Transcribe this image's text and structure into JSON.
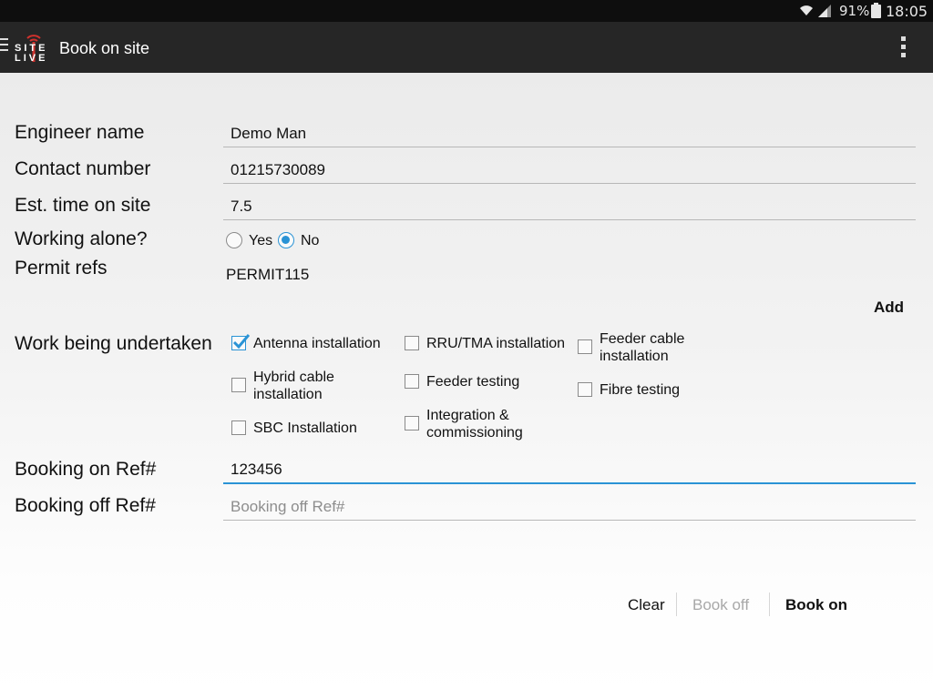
{
  "status_bar": {
    "battery_percent": "91%",
    "time": "18:05",
    "wifi_icon": "wifi-icon",
    "signal_icon": "signal-icon",
    "battery_icon": "battery-icon"
  },
  "action_bar": {
    "title": "Book on site",
    "logo_text_top": "SITE",
    "logo_text_bottom": "LIVE",
    "accent_color": "#d0312d",
    "menu_icon": "hamburger-icon",
    "overflow_icon": "overflow-menu-icon"
  },
  "form": {
    "engineer_name": {
      "label": "Engineer name",
      "value": "Demo Man"
    },
    "contact_number": {
      "label": "Contact number",
      "value": "01215730089"
    },
    "est_time": {
      "label": "Est. time on site",
      "value": "7.5"
    },
    "working_alone": {
      "label": "Working alone?",
      "options": [
        {
          "label": "Yes",
          "selected": false
        },
        {
          "label": "No",
          "selected": true
        }
      ]
    },
    "permit_refs": {
      "label": "Permit refs",
      "value": "PERMIT115",
      "add_label": "Add"
    },
    "work": {
      "label": "Work being undertaken",
      "options": [
        {
          "label": "Antenna installation",
          "checked": true
        },
        {
          "label": "RRU/TMA installation",
          "checked": false
        },
        {
          "label": "Feeder cable installation",
          "checked": false
        },
        {
          "label": "Hybrid cable installation",
          "checked": false
        },
        {
          "label": "Feeder testing",
          "checked": false
        },
        {
          "label": "Fibre testing",
          "checked": false
        },
        {
          "label": "SBC Installation",
          "checked": false
        },
        {
          "label": "Integration & commissioning",
          "checked": false
        }
      ]
    },
    "booking_on": {
      "label": "Booking on Ref#",
      "value": "123456"
    },
    "booking_off": {
      "label": "Booking off Ref#",
      "value": "",
      "placeholder": "Booking off Ref#"
    }
  },
  "buttons": {
    "clear": "Clear",
    "book_off": "Book off",
    "book_on": "Book on"
  },
  "colors": {
    "accent": "#2a93d5",
    "action_bar": "#262626",
    "status_bar": "#0e0e0e"
  }
}
